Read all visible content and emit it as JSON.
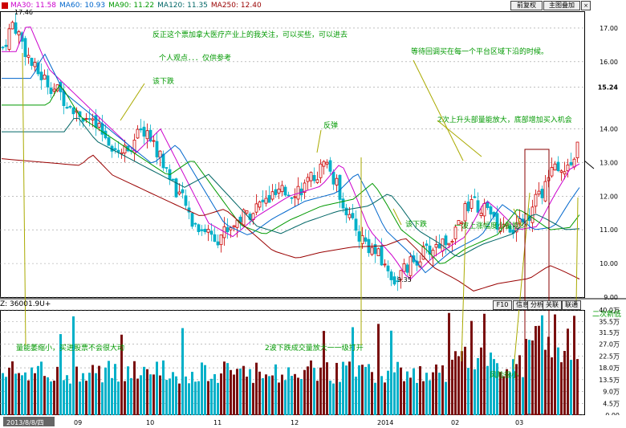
{
  "header": {
    "ma_items": [
      {
        "label": "MA30: 11.58",
        "color": "#cc00cc"
      },
      {
        "label": "MA60: 10.93",
        "color": "#0066cc"
      },
      {
        "label": "MA90: 11.22",
        "color": "#009900"
      },
      {
        "label": "MA120: 11.35",
        "color": "#006666"
      },
      {
        "label": "MA250: 12.40",
        "color": "#990000"
      }
    ],
    "buttons": [
      "前复权",
      "主图叠加"
    ],
    "vol_label": "Z: 36001.9U+",
    "vol_buttons": [
      "F10",
      "信息",
      "分析",
      "关联",
      "联通"
    ]
  },
  "colors": {
    "up": "#cc0000",
    "down": "#00b0c8",
    "annotation": "#009900",
    "arrow": "#888800"
  },
  "chart_data": {
    "type": "candlestick",
    "price_axis": {
      "ylim": [
        9,
        17.5
      ],
      "ticks": [
        "17.00",
        "16.00",
        "15.24",
        "14.00",
        "13.00",
        "12.00",
        "11.00",
        "10.00",
        "9.00"
      ],
      "tick_values": [
        17,
        16,
        15.24,
        14,
        13,
        12,
        11,
        10,
        9
      ]
    },
    "volume_axis": {
      "ylim": [
        0,
        40000
      ],
      "ticks": [
        "40.0万",
        "35.5万",
        "31.5万",
        "27.0万",
        "22.5万",
        "18.0万",
        "13.5万",
        "9.0万",
        "4.5万",
        "0.00"
      ],
      "tick_values": [
        40000,
        35500,
        31500,
        27000,
        22500,
        18000,
        13500,
        9000,
        4500,
        0
      ]
    },
    "x_labels": [
      "2013/8/8/四",
      "09",
      "10",
      "11",
      "12",
      "2014",
      "02",
      "03"
    ],
    "peak_label": "17.46",
    "low_label": "9.35",
    "annotations": [
      "反正这个票加拿大医疗产业上的我关注，可以买些，可以进去",
      "个人观点．．．仅供参考",
      "等待回调买在每一个平台区域下沿的时候。",
      "该下跌",
      "反弹",
      "2次上升头部量能放大，底部增加买入机会",
      "一波上涨幅度小量能少",
      "该下跌",
      "量能萎缩小，买进股票不会很大动",
      "2波下跌成交量放大一一级打开",
      "风险很小",
      "二次新低"
    ]
  }
}
